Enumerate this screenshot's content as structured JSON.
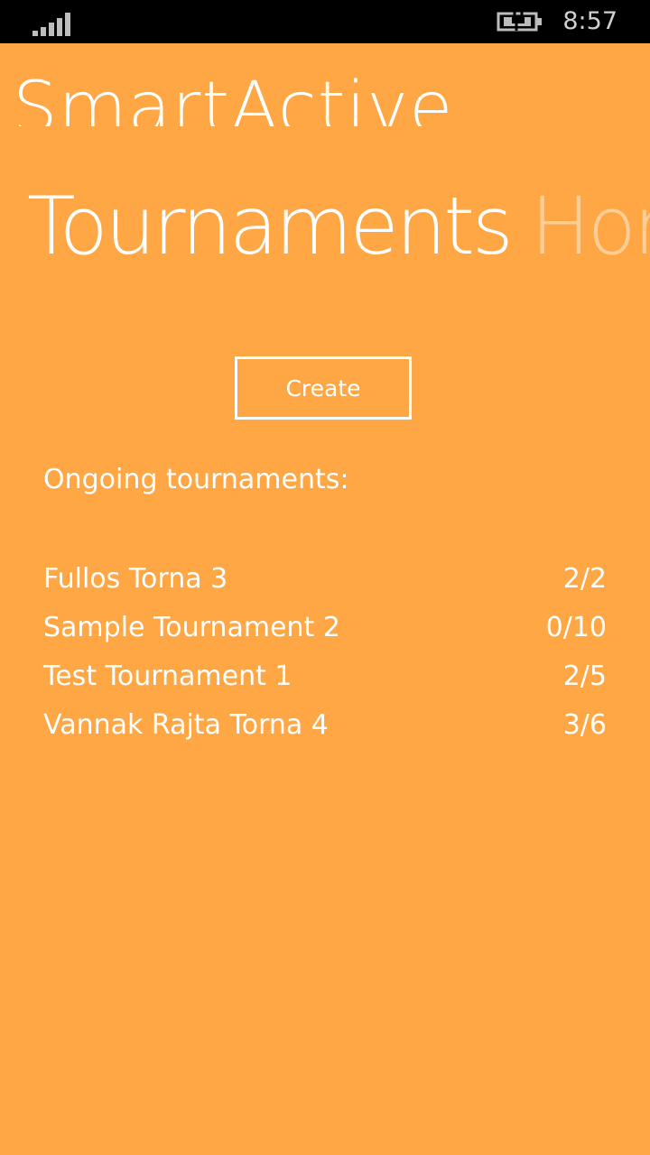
{
  "status_bar": {
    "time": "8:57",
    "signal_icon": "signal-bars-icon",
    "battery_icon": "battery-charging-icon"
  },
  "app_title": "SmartActive",
  "pivot": {
    "active": "Tournaments",
    "next": "Home"
  },
  "create_button": "Create",
  "section_label": "Ongoing tournaments:",
  "tournaments": [
    {
      "name": "Fullos Torna 3",
      "count": "2/2"
    },
    {
      "name": "Sample Tournament 2",
      "count": "0/10"
    },
    {
      "name": "Test Tournament 1",
      "count": "2/5"
    },
    {
      "name": "Vannak Rajta Torna 4",
      "count": "3/6"
    }
  ],
  "colors": {
    "background": "#FFA744",
    "text": "#FFFFFF",
    "status_bar": "#000000"
  }
}
